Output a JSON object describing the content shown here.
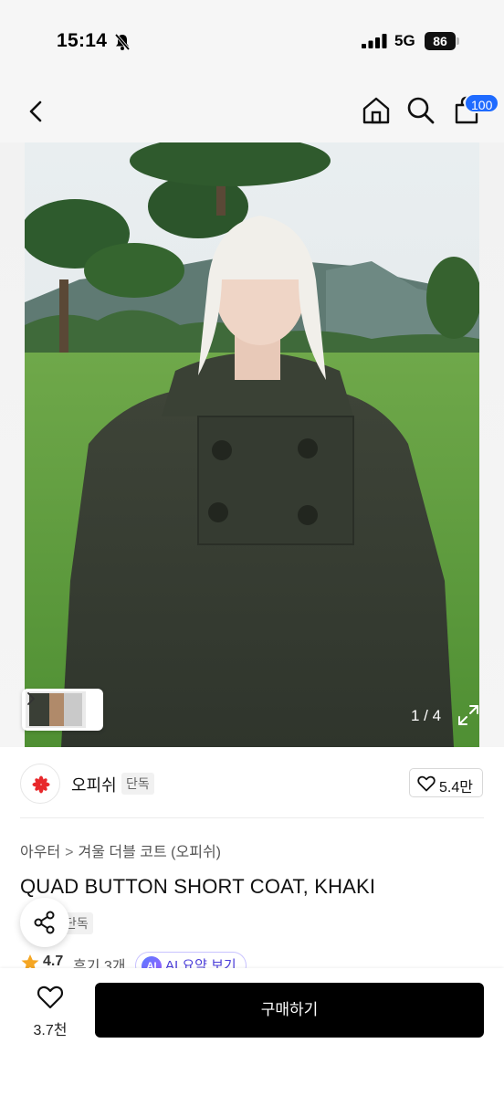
{
  "status_bar": {
    "time": "15:14",
    "network": "5G",
    "battery": "86",
    "icons": [
      "bell-off-icon",
      "signal-icon",
      "battery-icon"
    ]
  },
  "header": {
    "icons": [
      "back-arrow-icon",
      "home-icon",
      "search-icon",
      "cart-icon"
    ],
    "cart_badge": "100"
  },
  "gallery": {
    "page_counter": "1 / 4",
    "icons": [
      "chevron-right-icon",
      "expand-icon"
    ]
  },
  "brand": {
    "name": "오피쉬",
    "tag": "단독",
    "like_count": "5.4만",
    "icons": [
      "heart-icon"
    ]
  },
  "product": {
    "breadcrumb": [
      "아우터",
      "겨울 더블 코트 (오피쉬)"
    ],
    "title": "QUAD BUTTON SHORT COAT, KHAKI",
    "exclusive_tag": "단독",
    "rating": "4.7",
    "review_count": "후기 3개",
    "ai_badge": "AI",
    "ai_summary": "AI 요약 보기",
    "icons": [
      "share-icon",
      "star-icon"
    ]
  },
  "bottom_bar": {
    "wish_count": "3.7천",
    "buy_label": "구매하기",
    "icons": [
      "heart-outline-icon"
    ]
  },
  "colors": {
    "accent_blue": "#1f6bff",
    "buy_button": "#000000",
    "ai_purple": "#4a3dd8",
    "star": "#f5a623"
  }
}
